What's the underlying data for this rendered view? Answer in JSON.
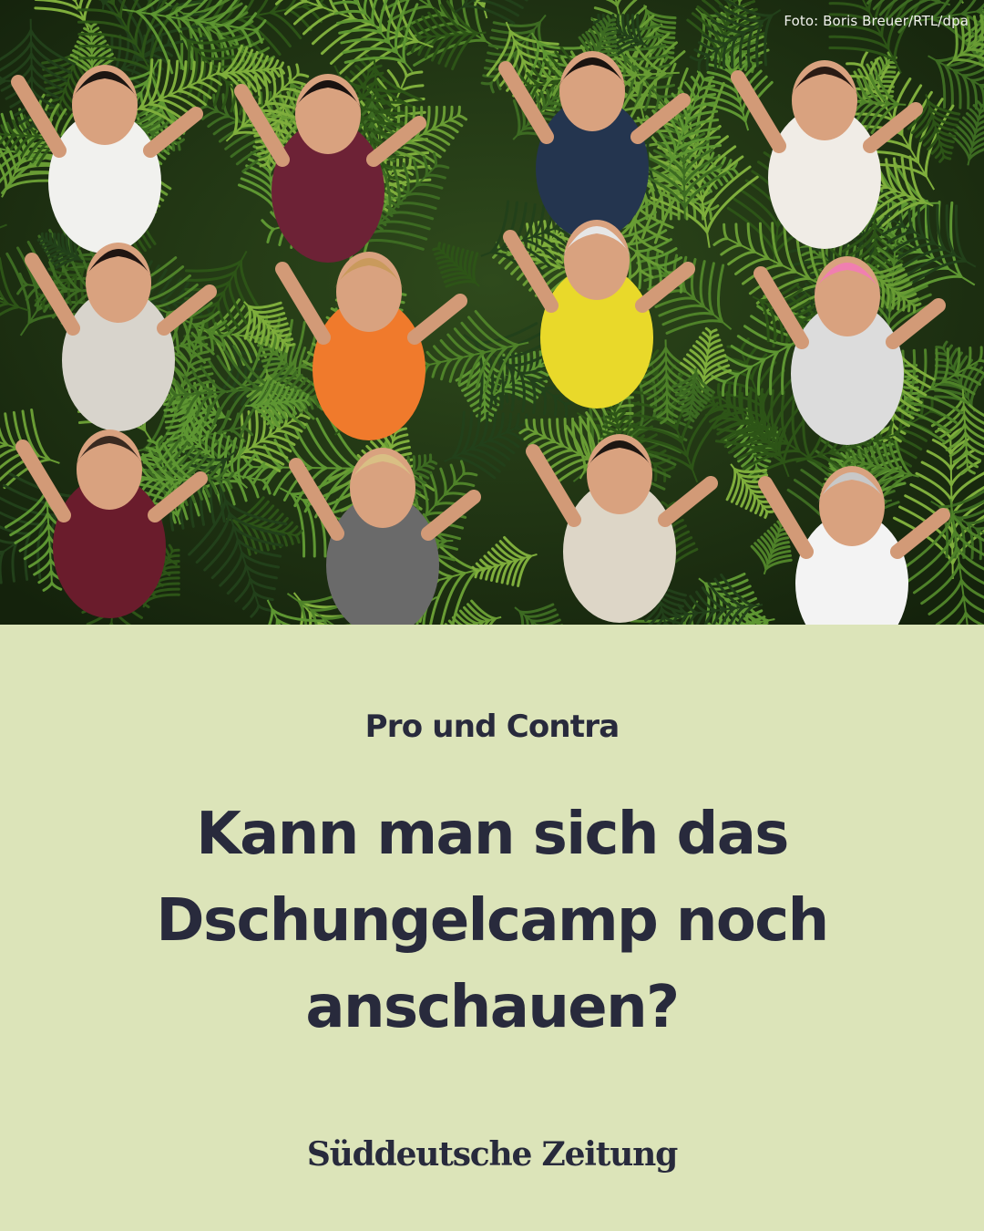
{
  "photo": {
    "credit": "Foto: Boris Breuer/RTL/dpa",
    "colors": {
      "jungle_dark": "#1e2f15",
      "leaf": "#3d6b22",
      "leaf_light": "#7fae3c"
    }
  },
  "article": {
    "kicker": "Pro und Contra",
    "headline_lines": [
      "Kann man sich das",
      "Dschungelcamp noch",
      "anschauen?"
    ]
  },
  "brand": {
    "logo_text": "Süddeutsche Zeitung"
  },
  "theme": {
    "background": "#dce4b9",
    "text": "#282a3c"
  }
}
